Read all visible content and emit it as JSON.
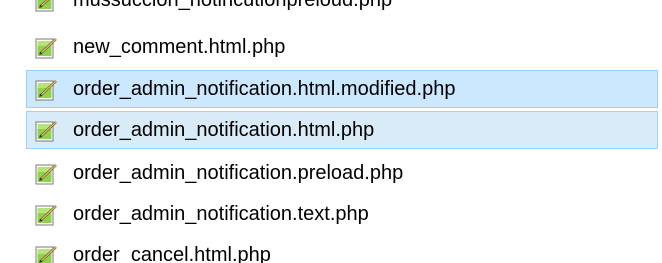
{
  "file_list": {
    "items": [
      {
        "name": "mussuccion_notincutionpreloud.php",
        "state": "normal",
        "icon": "php-file-icon"
      },
      {
        "name": "new_comment.html.php",
        "state": "normal",
        "icon": "php-file-icon"
      },
      {
        "name": "order_admin_notification.html.modified.php",
        "state": "selected",
        "icon": "php-file-icon"
      },
      {
        "name": "order_admin_notification.html.php",
        "state": "selected-focused",
        "icon": "php-file-icon"
      },
      {
        "name": "order_admin_notification.preload.php",
        "state": "normal",
        "icon": "php-file-icon"
      },
      {
        "name": "order_admin_notification.text.php",
        "state": "normal",
        "icon": "php-file-icon"
      },
      {
        "name": "order_cancel.html.php",
        "state": "normal",
        "icon": "php-file-icon"
      }
    ]
  },
  "colors": {
    "selected_bg": "#cce8ff",
    "selected_border": "#99d1ff",
    "focused_bg": "#d9ebf7"
  }
}
